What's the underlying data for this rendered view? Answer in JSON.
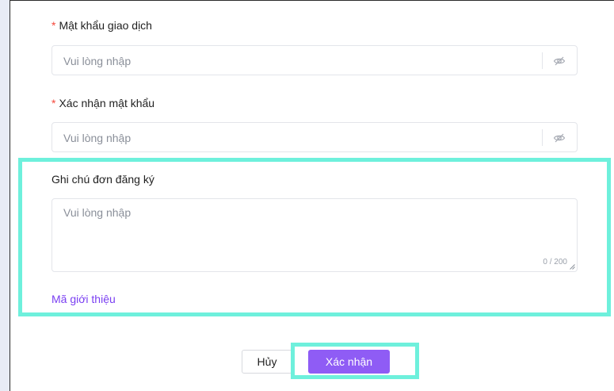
{
  "form": {
    "password": {
      "label": "Mật khẩu giao dịch",
      "required_mark": "*",
      "placeholder": "Vui lòng nhập",
      "icon": "eye-off-icon"
    },
    "confirm_password": {
      "label": "Xác nhận mật khẩu",
      "required_mark": "*",
      "placeholder": "Vui lòng nhập",
      "icon": "eye-off-icon"
    },
    "note": {
      "label": "Ghi chú đơn đăng ký",
      "placeholder": "Vui lòng nhập",
      "counter": "0 / 200"
    },
    "referral_link": "Mã giới thiệu"
  },
  "actions": {
    "cancel_label": "Hủy",
    "confirm_label": "Xác nhận"
  },
  "colors": {
    "accent": "#8f5cf5",
    "link": "#7a3ff2",
    "required": "#f5483b",
    "highlight": "#6ef0dc"
  }
}
